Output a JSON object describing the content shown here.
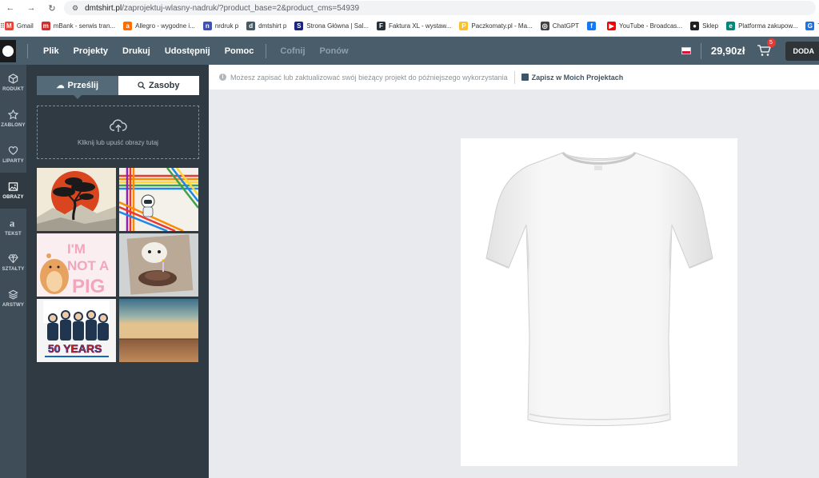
{
  "browser": {
    "url_host": "dmtshirt.pl",
    "url_path": "/zaprojektuj-wlasny-nadruk/?product_base=2&product_cms=54939",
    "bookmarks": [
      {
        "label": "Gmail",
        "color": "#ea4335",
        "glyph": "M"
      },
      {
        "label": "mBank - serwis tran...",
        "color": "#d32f2f",
        "glyph": "m"
      },
      {
        "label": "Allegro - wygodne i...",
        "color": "#ff6d00",
        "glyph": "a"
      },
      {
        "label": "nrdruk p",
        "color": "#3f51b5",
        "glyph": "n"
      },
      {
        "label": "dmtshirt p",
        "color": "#455a64",
        "glyph": "d"
      },
      {
        "label": "Strona Główna | Sal...",
        "color": "#1a237e",
        "glyph": "S"
      },
      {
        "label": "Faktura XL - wystaw...",
        "color": "#263238",
        "glyph": "F"
      },
      {
        "label": "Paczkomaty.pl - Ma...",
        "color": "#fbc02d",
        "glyph": "P"
      },
      {
        "label": "ChatGPT",
        "color": "#424242",
        "glyph": "◎"
      },
      {
        "label": "",
        "color": "#1877f2",
        "glyph": "f"
      },
      {
        "label": "YouTube - Broadcas...",
        "color": "#ff0000",
        "glyph": "▶"
      },
      {
        "label": "Sklep",
        "color": "#212121",
        "glyph": "●"
      },
      {
        "label": "Platforma zakupow...",
        "color": "#00897b",
        "glyph": "e"
      },
      {
        "label": "T",
        "color": "#1a73e8",
        "glyph": "G"
      }
    ]
  },
  "header": {
    "menu": [
      "Plik",
      "Projekty",
      "Drukuj",
      "Udostępnij",
      "Pomoc"
    ],
    "undo": "Cofnij",
    "redo": "Ponów",
    "price": "29,90zł",
    "cart_count": "5",
    "add_label": "DODA"
  },
  "iconbar": [
    {
      "label": "RODUKT",
      "icon": "cube-icon"
    },
    {
      "label": "ZABLONY",
      "icon": "star-icon"
    },
    {
      "label": "LIPARTY",
      "icon": "heart-icon"
    },
    {
      "label": "OBRAZY",
      "icon": "image-icon"
    },
    {
      "label": "TEKST",
      "icon": "text-icon"
    },
    {
      "label": "SZTAŁTY",
      "icon": "diamond-icon"
    },
    {
      "label": "ARSTWY",
      "icon": "layers-icon"
    }
  ],
  "panel": {
    "tab_upload": "Prześlij",
    "tab_assets": "Zasoby",
    "dropzone_text": "Kliknij lub upuść obrazy tutaj",
    "thumb_text_pig": "I'M NOT A PIG",
    "thumb_text_years": "50 YEARS"
  },
  "infobar": {
    "message": "Możesz zapisać lub zaktualizować swój bieżący projekt do późniejszego wykorzystania",
    "save_link": "Zapisz w Moich Projektach"
  }
}
